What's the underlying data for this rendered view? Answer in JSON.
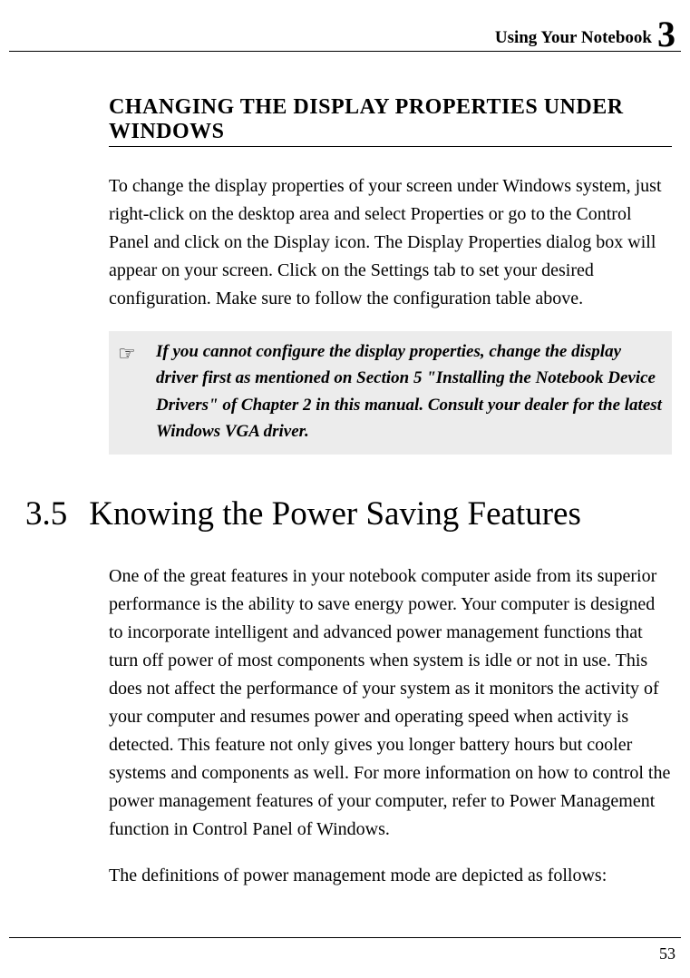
{
  "header": {
    "running_title": "Using Your Notebook",
    "chapter_number": "3"
  },
  "section1": {
    "heading": "CHANGING THE DISPLAY PROPERTIES UNDER WINDOWS",
    "paragraph": "To change the display properties of your screen under Windows system, just right-click on the desktop area and select Properties or go to the Control Panel and click on the Display icon. The Display Properties dialog box will appear on your screen. Click on the Settings tab to set your desired configuration. Make sure to follow the configuration table above."
  },
  "note": {
    "icon": "☞",
    "text": "If you cannot configure the display properties, change the display driver first as mentioned on Section 5 \"Installing the Notebook Device Drivers\" of Chapter 2 in this manual. Consult your dealer for the latest Windows VGA driver."
  },
  "section2": {
    "number": "3.5",
    "title": "Knowing the Power Saving Features",
    "paragraph1": "One of the great features in your notebook computer aside from its superior performance is the ability to save energy power. Your computer is designed to incorporate intelligent and advanced power management functions that turn off power of most components when system is idle or not in use. This does not affect the performance of your system as it monitors the activity of your computer and resumes power and operating speed when activity is detected. This feature not only gives you longer battery hours but cooler systems and components as well. For more information on how to control the power management features of your computer, refer to Power Management function in Control Panel of Windows.",
    "paragraph2": "The definitions of power management mode are depicted as follows:"
  },
  "footer": {
    "page_number": "53"
  }
}
